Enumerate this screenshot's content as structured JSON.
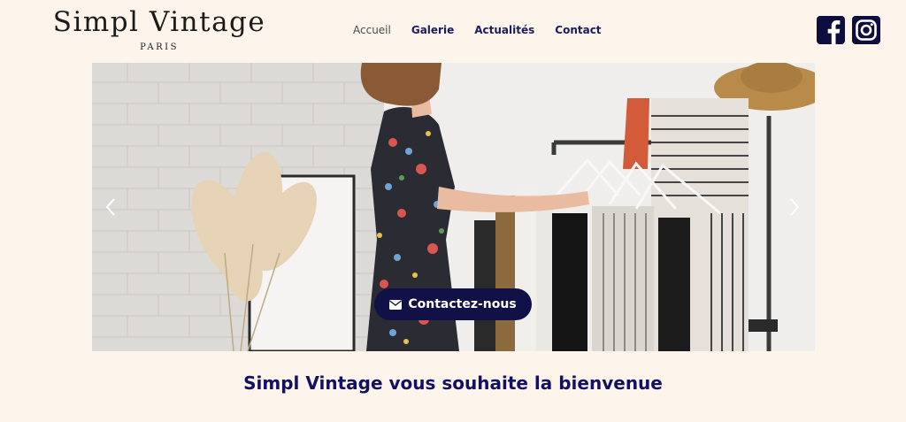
{
  "brand": {
    "name": "Simpl Vintage",
    "location": "PARIS"
  },
  "nav": {
    "items": [
      {
        "label": "Accueil",
        "active": true
      },
      {
        "label": "Galerie",
        "active": false
      },
      {
        "label": "Actualités",
        "active": false
      },
      {
        "label": "Contact",
        "active": false
      }
    ]
  },
  "social": {
    "icons": [
      "facebook-icon",
      "instagram-icon"
    ],
    "color": "#0d0d3f"
  },
  "hero": {
    "cta_label": "Contactez-nous",
    "cta_icon": "envelope-icon",
    "cta_color": "#111147"
  },
  "welcome": {
    "text": "Simpl Vintage vous souhaite la bienvenue"
  },
  "colors": {
    "background": "#fdf5ec",
    "primary": "#121163"
  }
}
